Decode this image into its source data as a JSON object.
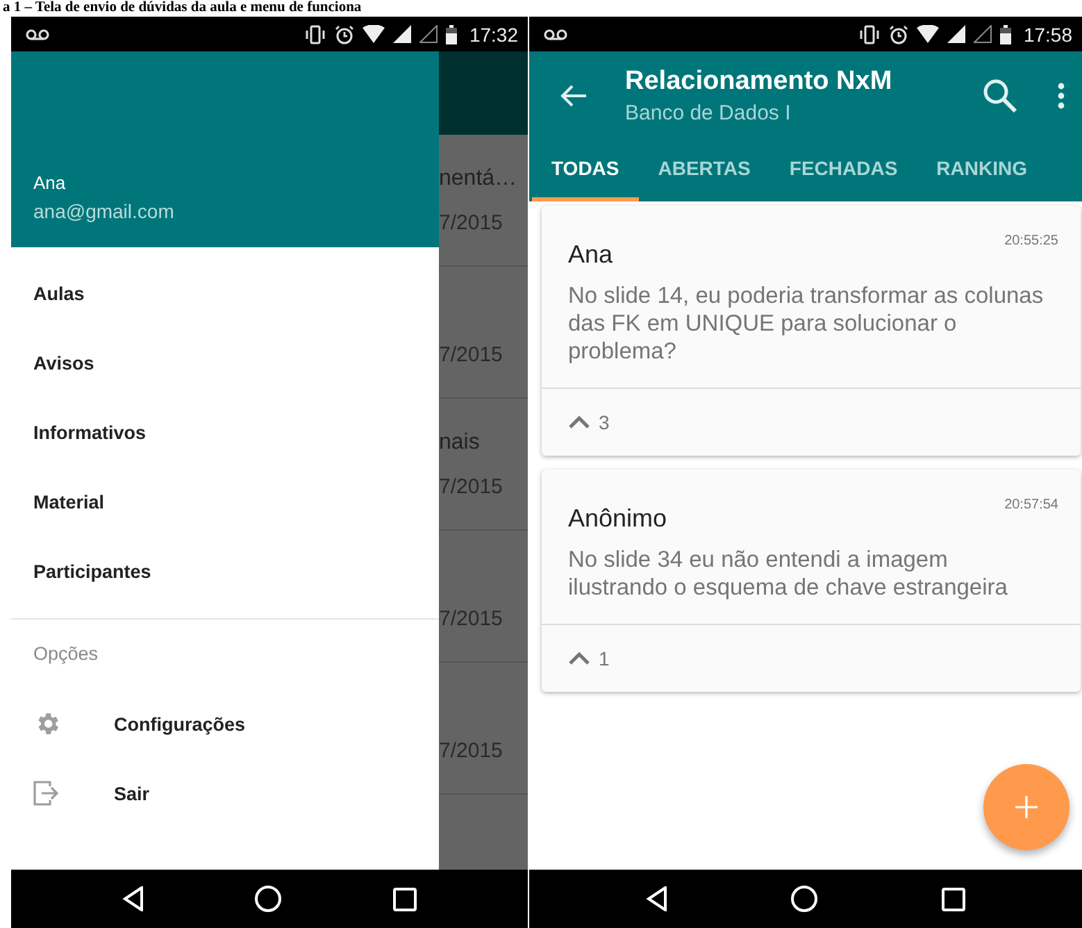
{
  "caption": "a 1 – Tela de envio de dúvidas da aula e menu de funciona",
  "left_phone": {
    "status_bar": {
      "time": "17:32"
    },
    "drawer": {
      "user_name": "Ana",
      "email": "ana@gmail.com",
      "items": [
        {
          "label": "Aulas"
        },
        {
          "label": "Avisos"
        },
        {
          "label": "Informativos"
        },
        {
          "label": "Material"
        },
        {
          "label": "Participantes"
        }
      ],
      "section_title": "Opções",
      "options": [
        {
          "kind": "settings",
          "label": "Configurações"
        },
        {
          "kind": "exit",
          "label": "Sair"
        }
      ]
    },
    "background_list": [
      {
        "title": "nentá…",
        "date": "7/2015"
      },
      {
        "date": "7/2015"
      },
      {
        "title": "nais",
        "date": "7/2015"
      },
      {
        "date": "7/2015"
      },
      {
        "date": "7/2015"
      }
    ]
  },
  "right_phone": {
    "status_bar": {
      "time": "17:58"
    },
    "toolbar": {
      "title": "Relacionamento NxM",
      "subtitle": "Banco de Dados I"
    },
    "tabs": [
      {
        "label": "TODAS",
        "selected": true
      },
      {
        "label": "ABERTAS",
        "selected": false
      },
      {
        "label": "FECHADAS",
        "selected": false
      },
      {
        "label": "RANKING",
        "selected": false
      }
    ],
    "questions": [
      {
        "author": "Ana",
        "time": "20:55:25",
        "text": "No slide 14, eu poderia transformar as colunas das FK em UNIQUE para solucionar o problema?",
        "votes": "3"
      },
      {
        "author": "Anônimo",
        "time": "20:57:54",
        "text": "No slide 34 eu não entendi a imagem ilustrando o esquema de chave estrangeira",
        "votes": "1"
      }
    ]
  }
}
